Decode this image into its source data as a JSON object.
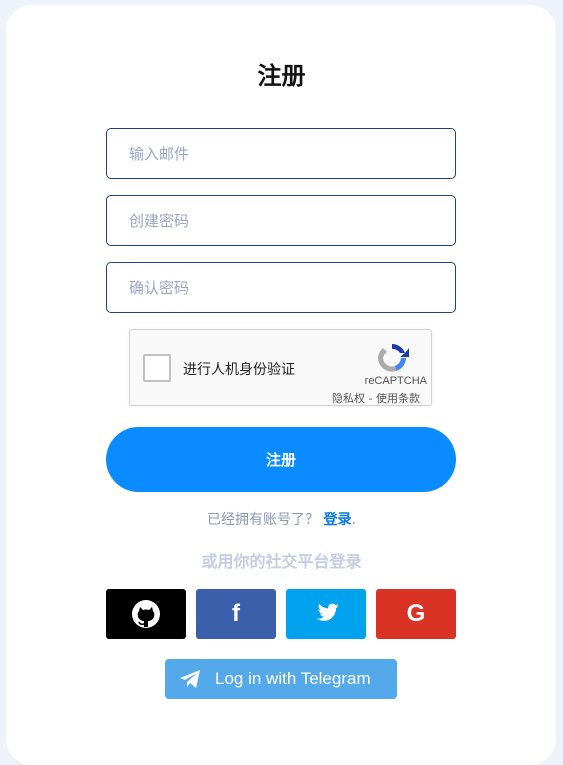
{
  "form": {
    "title": "注册",
    "email_placeholder": "输入邮件",
    "password_placeholder": "创建密码",
    "confirm_placeholder": "确认密码",
    "submit_label": "注册"
  },
  "captcha": {
    "label": "进行人机身份验证",
    "brand": "reCAPTCHA",
    "links": "隐私权 - 使用条款"
  },
  "login": {
    "prompt": "已经拥有账号了？",
    "link": "登录",
    "trailing": "."
  },
  "social": {
    "title": "或用你的社交平台登录",
    "buttons": [
      {
        "name": "github",
        "icon": "github-icon",
        "color": "#000000"
      },
      {
        "name": "facebook",
        "icon": "facebook-icon",
        "glyph": "f",
        "color": "#3b5faa"
      },
      {
        "name": "twitter",
        "icon": "twitter-icon",
        "color": "#00a2ed"
      },
      {
        "name": "google",
        "icon": "google-icon",
        "glyph": "G",
        "color": "#db3226"
      }
    ],
    "telegram_label": "Log in with Telegram",
    "telegram_color": "#54a9eb"
  },
  "colors": {
    "accent": "#0a8bff",
    "background": "#eef3fb",
    "field_border": "#1f3f8f"
  }
}
